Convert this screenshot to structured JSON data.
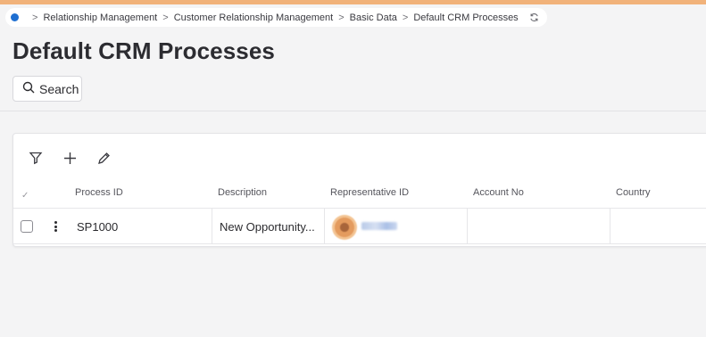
{
  "breadcrumb": {
    "items": [
      "Relationship Management",
      "Customer Relationship Management",
      "Basic Data",
      "Default CRM Processes"
    ]
  },
  "page": {
    "title": "Default CRM Processes",
    "search_label": "Search"
  },
  "table": {
    "columns": [
      "Process ID",
      "Description",
      "Representative ID",
      "Account No",
      "Country"
    ],
    "rows": [
      {
        "process_id": "SP1000",
        "description": "New Opportunity...",
        "representative_id": "",
        "account_no": "",
        "country": ""
      }
    ]
  },
  "colors": {
    "accent": "#f1b27a",
    "home_dot": "#1f6fd1"
  }
}
